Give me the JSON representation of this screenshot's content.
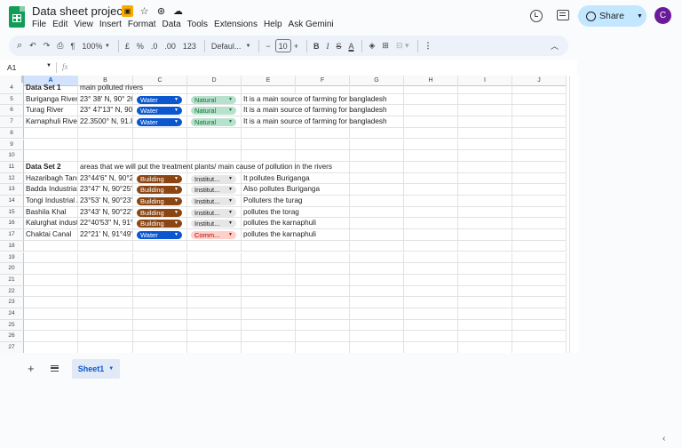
{
  "doc": {
    "title": "Data sheet project",
    "menu": [
      "File",
      "Edit",
      "View",
      "Insert",
      "Format",
      "Data",
      "Tools",
      "Extensions",
      "Help",
      "Ask Gemini"
    ],
    "share_label": "Share",
    "avatar_letter": "C"
  },
  "toolbar": {
    "zoom": "100%",
    "currency": "£",
    "percent": "%",
    "dec_decrease": ".0",
    "dec_increase": ".00",
    "format_123": "123",
    "font": "Defaul...",
    "font_size": "10",
    "bold": "B",
    "italic": "I",
    "text_color_letter": "A"
  },
  "formula": {
    "cell_ref": "A1",
    "fx": "fx"
  },
  "columns": [
    "A",
    "B",
    "C",
    "D",
    "E",
    "F",
    "G",
    "H",
    "I",
    "J"
  ],
  "rows": [
    {
      "n": "4",
      "a": "Data Set 1",
      "a_bold": true,
      "b": "main polluted rivers",
      "b_overflow": true
    },
    {
      "n": "5",
      "a": "Buriganga River",
      "b": "23° 38' N, 90° 26",
      "c": {
        "label": "Water",
        "style": "water"
      },
      "d": {
        "label": "Natural",
        "style": "natural"
      },
      "e": "It is a main source of farming for bangladesh"
    },
    {
      "n": "6",
      "a": "Turag River",
      "b": "23° 47'13\" N, 90",
      "c": {
        "label": "Water",
        "style": "water"
      },
      "d": {
        "label": "Natural",
        "style": "natural"
      },
      "e": "It is a main source of farming for bangladesh"
    },
    {
      "n": "7",
      "a": "Karnaphuli River",
      "b": "22.3500° N, 91.8",
      "c": {
        "label": "Water",
        "style": "water"
      },
      "d": {
        "label": "Natural",
        "style": "natural"
      },
      "e": "It is a main source of farming for bangladesh"
    },
    {
      "n": "8"
    },
    {
      "n": "9"
    },
    {
      "n": "10"
    },
    {
      "n": "11",
      "a": "Data Set 2",
      "a_bold": true,
      "b": "areas that we will put the treatment plants/ main cause of pollution in the rivers",
      "b_overflow": true
    },
    {
      "n": "12",
      "a": "Hazaribagh Tann",
      "b": "23°44'6\" N, 90°2",
      "c": {
        "label": "Building",
        "style": "building"
      },
      "d": {
        "label": "Institut...",
        "style": "inst"
      },
      "e": "It pollutes Buriganga"
    },
    {
      "n": "13",
      "a": "Badda Industrial",
      "b": "23°47' N, 90°25'",
      "c": {
        "label": "Building",
        "style": "building"
      },
      "d": {
        "label": "Institut...",
        "style": "inst"
      },
      "e": "Also pollutes Buriganga"
    },
    {
      "n": "14",
      "a": "Tongi Industrial /",
      "b": "23°53' N, 90°23'",
      "c": {
        "label": "Building",
        "style": "building"
      },
      "d": {
        "label": "Institut...",
        "style": "inst"
      },
      "e": "Polluters the turag"
    },
    {
      "n": "15",
      "a": "Bashila Khal",
      "b": "23°43' N, 90°22'",
      "c": {
        "label": "Building",
        "style": "building"
      },
      "d": {
        "label": "Institut...",
        "style": "inst"
      },
      "e": "pollutes the torag"
    },
    {
      "n": "16",
      "a": "Kalurghat indust",
      "b": "22°40'53\" N, 91°",
      "c": {
        "label": "Building",
        "style": "building"
      },
      "d": {
        "label": "Institut...",
        "style": "inst"
      },
      "e": "pollutes the karnaphuli"
    },
    {
      "n": "17",
      "a": "Chaktai Canal",
      "b": "22°21' N, 91°49'",
      "c": {
        "label": "Water",
        "style": "water"
      },
      "d": {
        "label": "Comm...",
        "style": "comm"
      },
      "e": "pollutes the karnaphuli"
    },
    {
      "n": "18"
    },
    {
      "n": "19"
    },
    {
      "n": "20"
    },
    {
      "n": "21"
    },
    {
      "n": "22"
    },
    {
      "n": "23"
    },
    {
      "n": "24"
    },
    {
      "n": "25"
    },
    {
      "n": "26"
    },
    {
      "n": "27"
    }
  ],
  "chip_styles": {
    "water": {
      "bg": "#0b57d0",
      "fg": "#ffffff"
    },
    "natural": {
      "bg": "#b7e1cd",
      "fg": "#137333"
    },
    "building": {
      "bg": "#8b4513",
      "fg": "#ffffff"
    },
    "inst": {
      "bg": "#e6e6e6",
      "fg": "#1f1f1f"
    },
    "comm": {
      "bg": "#ffcfc9",
      "fg": "#b10202"
    }
  },
  "sheet_tab": "Sheet1"
}
